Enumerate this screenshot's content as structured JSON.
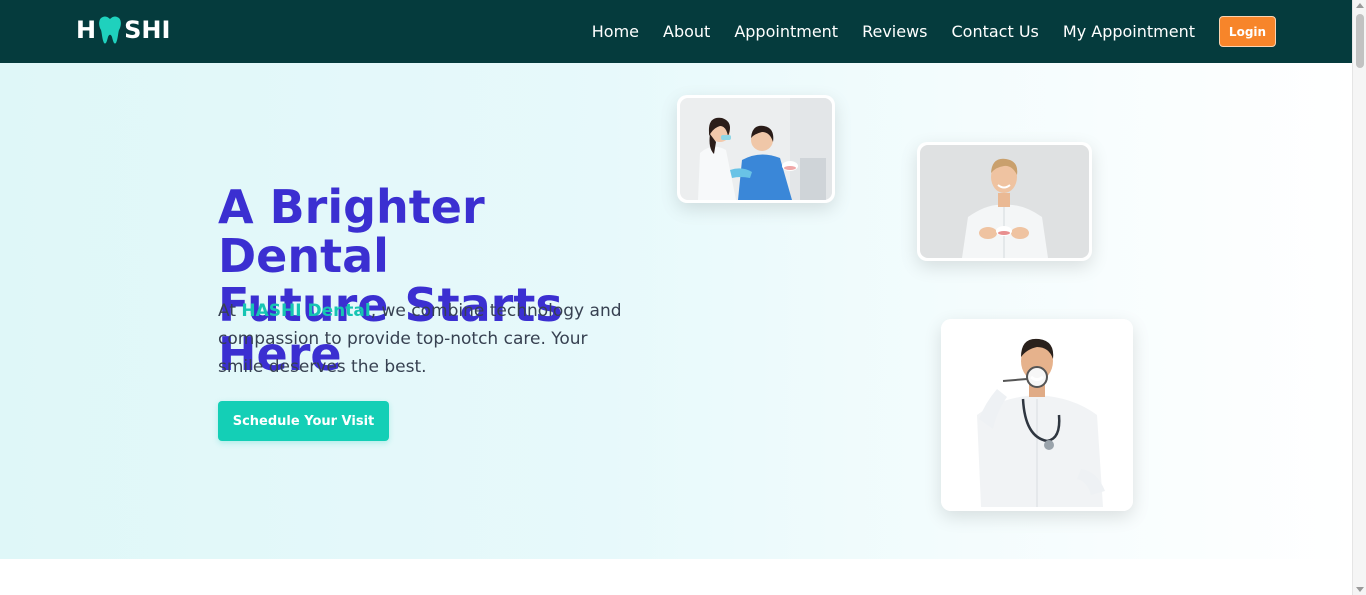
{
  "brand": {
    "logo_left": "H",
    "logo_right": "SHI",
    "logo_icon": "tooth-icon"
  },
  "nav": {
    "items": [
      {
        "label": "Home"
      },
      {
        "label": "About"
      },
      {
        "label": "Appointment"
      },
      {
        "label": "Reviews"
      },
      {
        "label": "Contact Us"
      },
      {
        "label": "My Appointment"
      }
    ],
    "login_label": "Login"
  },
  "hero": {
    "title_line1": "A Brighter Dental",
    "title_line2": "Future Starts Here",
    "text_prefix": "At ",
    "brand_name": "HASHI Dental",
    "text_suffix": ", we combine technology and compassion to provide top-notch care. Your smile deserves the best.",
    "cta_label": "Schedule Your Visit"
  },
  "colors": {
    "navbar": "#053b3d",
    "title": "#3b2fd1",
    "accent": "#16c5b3",
    "cta": "#14cfb6",
    "login": "#f7852a"
  }
}
